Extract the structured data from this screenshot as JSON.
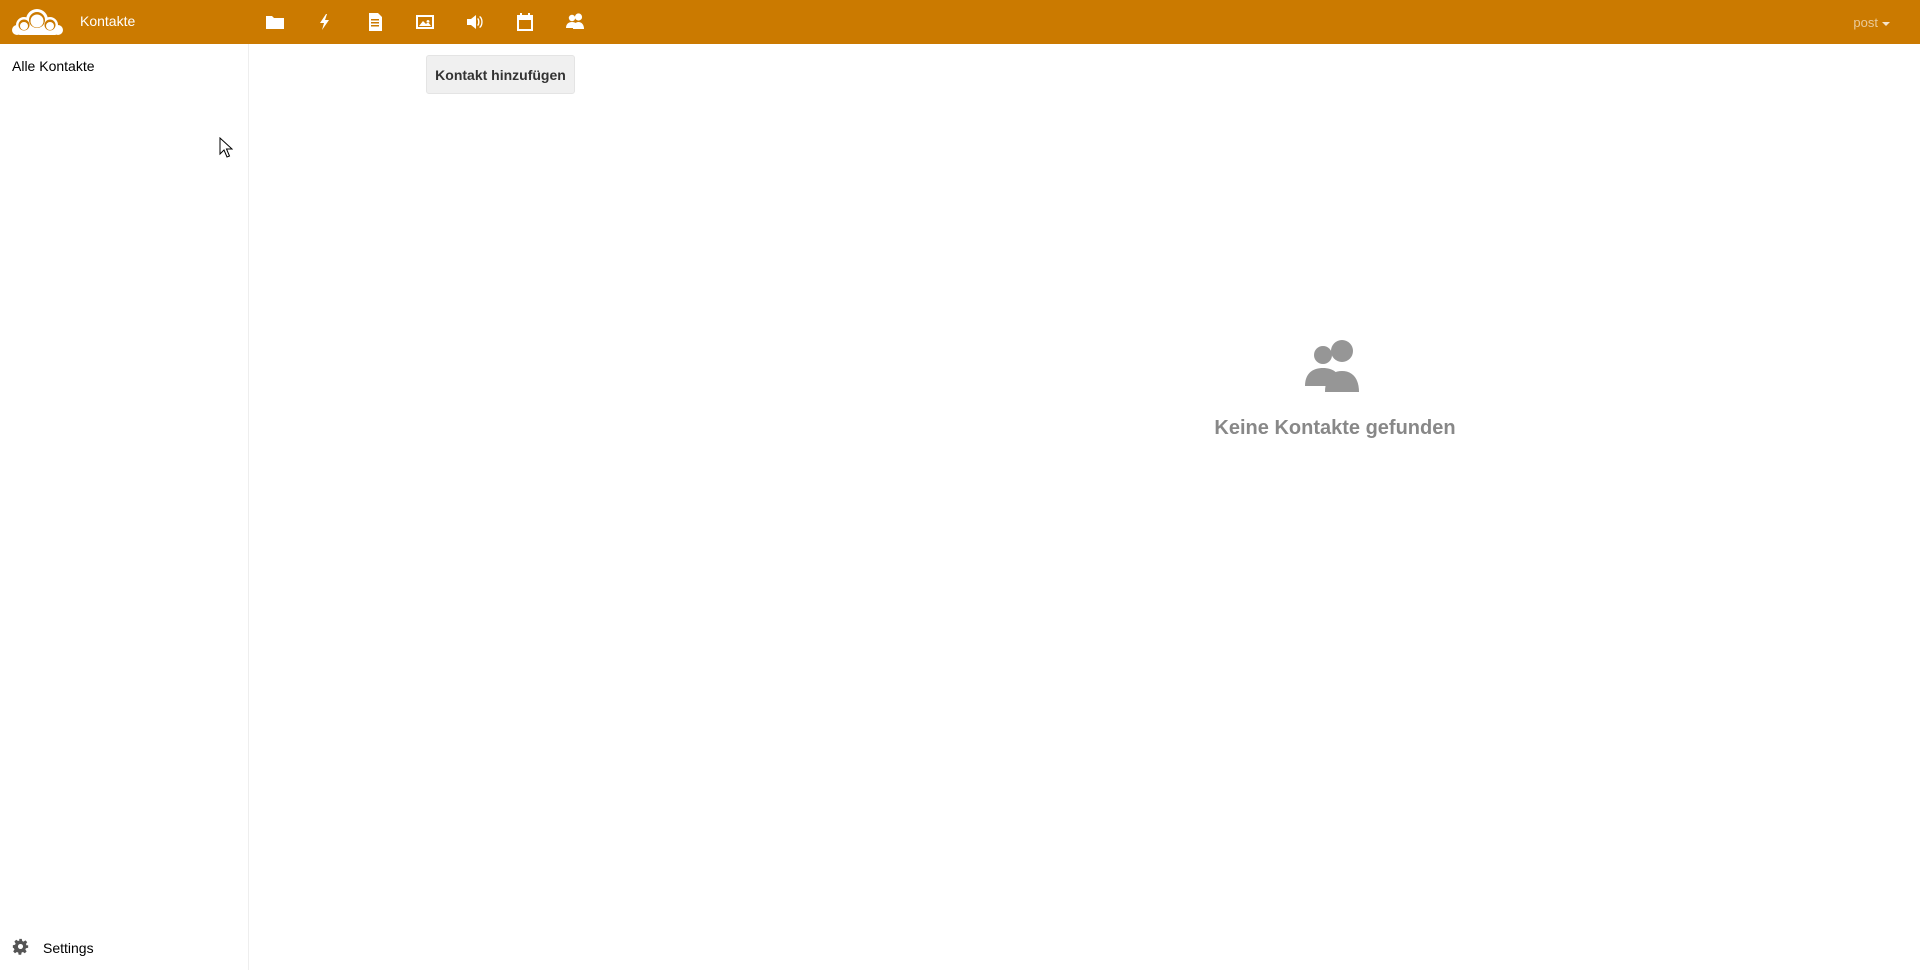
{
  "header": {
    "app_title": "Kontakte",
    "background_color": "#cb7a00",
    "apps": [
      {
        "name": "files",
        "icon": "folder-icon"
      },
      {
        "name": "activity",
        "icon": "lightning-icon"
      },
      {
        "name": "documents",
        "icon": "document-icon"
      },
      {
        "name": "gallery",
        "icon": "image-icon"
      },
      {
        "name": "music",
        "icon": "speaker-icon"
      },
      {
        "name": "calendar",
        "icon": "calendar-icon"
      },
      {
        "name": "contacts",
        "icon": "contacts-icon"
      }
    ],
    "user": "post"
  },
  "sidebar": {
    "nav_all": "Alle Kontakte",
    "settings_label": "Settings",
    "settings_icon": "gear-icon"
  },
  "main": {
    "add_button": "Kontakt hinzufügen",
    "empty_text": "Keine Kontakte gefunden",
    "empty_icon": "contacts-icon"
  }
}
